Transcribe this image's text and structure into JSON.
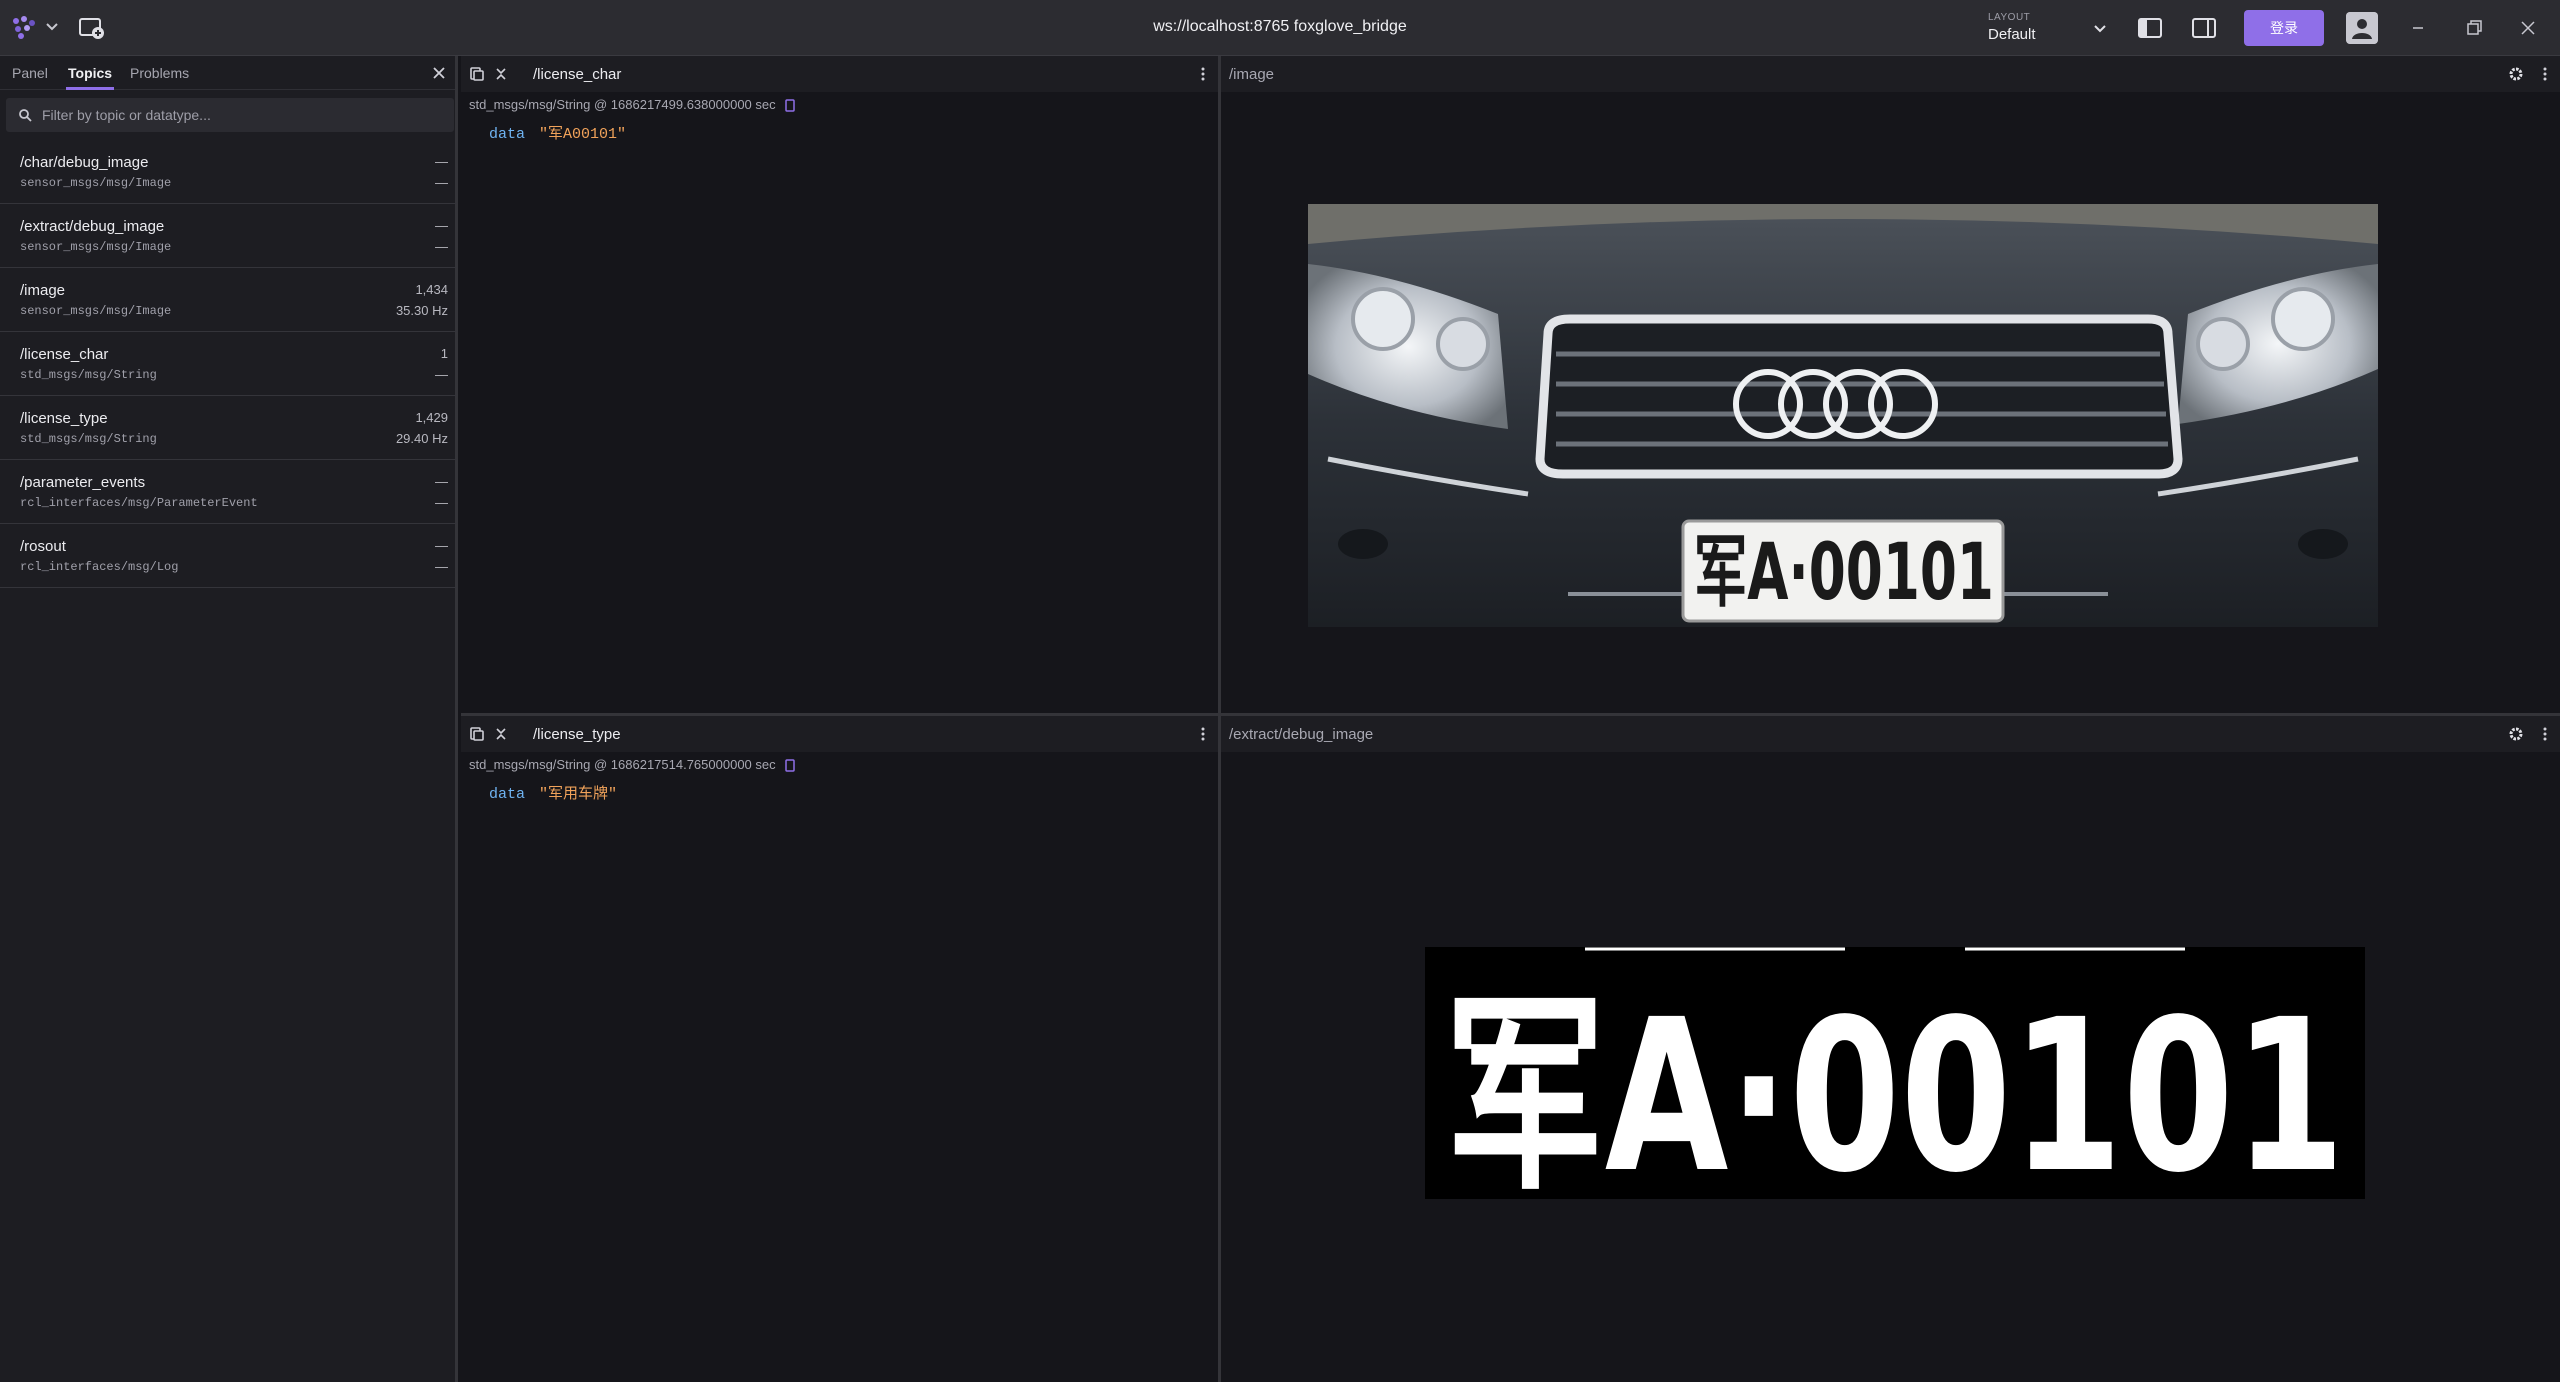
{
  "titlebar": {
    "connection": "ws://localhost:8765 foxglove_bridge",
    "layout_caption": "LAYOUT",
    "layout_name": "Default",
    "login_label": "登录"
  },
  "sidebar": {
    "tabs": [
      {
        "label": "Panel"
      },
      {
        "label": "Topics"
      },
      {
        "label": "Problems"
      }
    ],
    "active_tab": "Topics",
    "filter_placeholder": "Filter by topic or datatype...",
    "topics": [
      {
        "name": "/char/debug_image",
        "type": "sensor_msgs/msg/Image",
        "count": "—",
        "freq": "—"
      },
      {
        "name": "/extract/debug_image",
        "type": "sensor_msgs/msg/Image",
        "count": "—",
        "freq": "—"
      },
      {
        "name": "/image",
        "type": "sensor_msgs/msg/Image",
        "count": "1,434",
        "freq": "35.30 Hz"
      },
      {
        "name": "/license_char",
        "type": "std_msgs/msg/String",
        "count": "1",
        "freq": "—"
      },
      {
        "name": "/license_type",
        "type": "std_msgs/msg/String",
        "count": "1,429",
        "freq": "29.40 Hz"
      },
      {
        "name": "/parameter_events",
        "type": "rcl_interfaces/msg/ParameterEvent",
        "count": "—",
        "freq": "—"
      },
      {
        "name": "/rosout",
        "type": "rcl_interfaces/msg/Log",
        "count": "—",
        "freq": "—"
      }
    ]
  },
  "panels": {
    "license_char": {
      "title": "/license_char",
      "meta": "std_msgs/msg/String @ 1686217499.638000000 sec",
      "key": "data",
      "value": "\"军A00101\""
    },
    "image": {
      "title": "/image",
      "plate_text": "军A·00101"
    },
    "license_type": {
      "title": "/license_type",
      "meta": "std_msgs/msg/String @ 1686217514.765000000 sec",
      "key": "data",
      "value": "\"军用车牌\""
    },
    "debug_image": {
      "title": "/extract/debug_image",
      "plate_text": "军A·00101"
    }
  },
  "colors": {
    "accent": "#8f6fe8",
    "key": "#6fb3f2",
    "value": "#f0a25a",
    "background": "#15151a"
  }
}
